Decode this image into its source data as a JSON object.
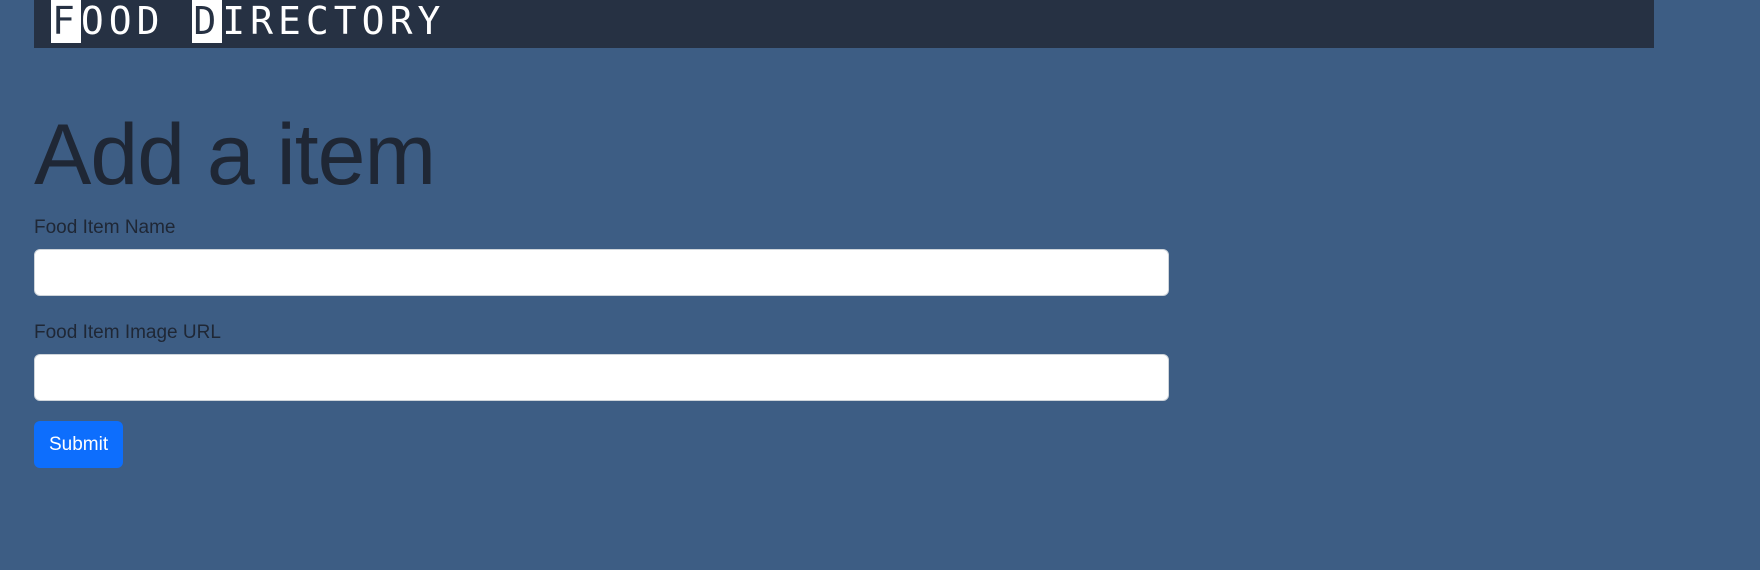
{
  "navbar": {
    "brand_parts": [
      "F",
      "OOD ",
      "D",
      "IRECTORY"
    ]
  },
  "main": {
    "title": "Add a item",
    "form": {
      "name_label": "Food Item Name",
      "name_value": "",
      "name_placeholder": "",
      "url_label": "Food Item Image URL",
      "url_value": "",
      "url_placeholder": "",
      "submit_label": "Submit"
    }
  },
  "colors": {
    "background": "#3d5d84",
    "navbar": "#263143",
    "primary_button": "#0d6efd",
    "text_dark": "#1f2735"
  }
}
